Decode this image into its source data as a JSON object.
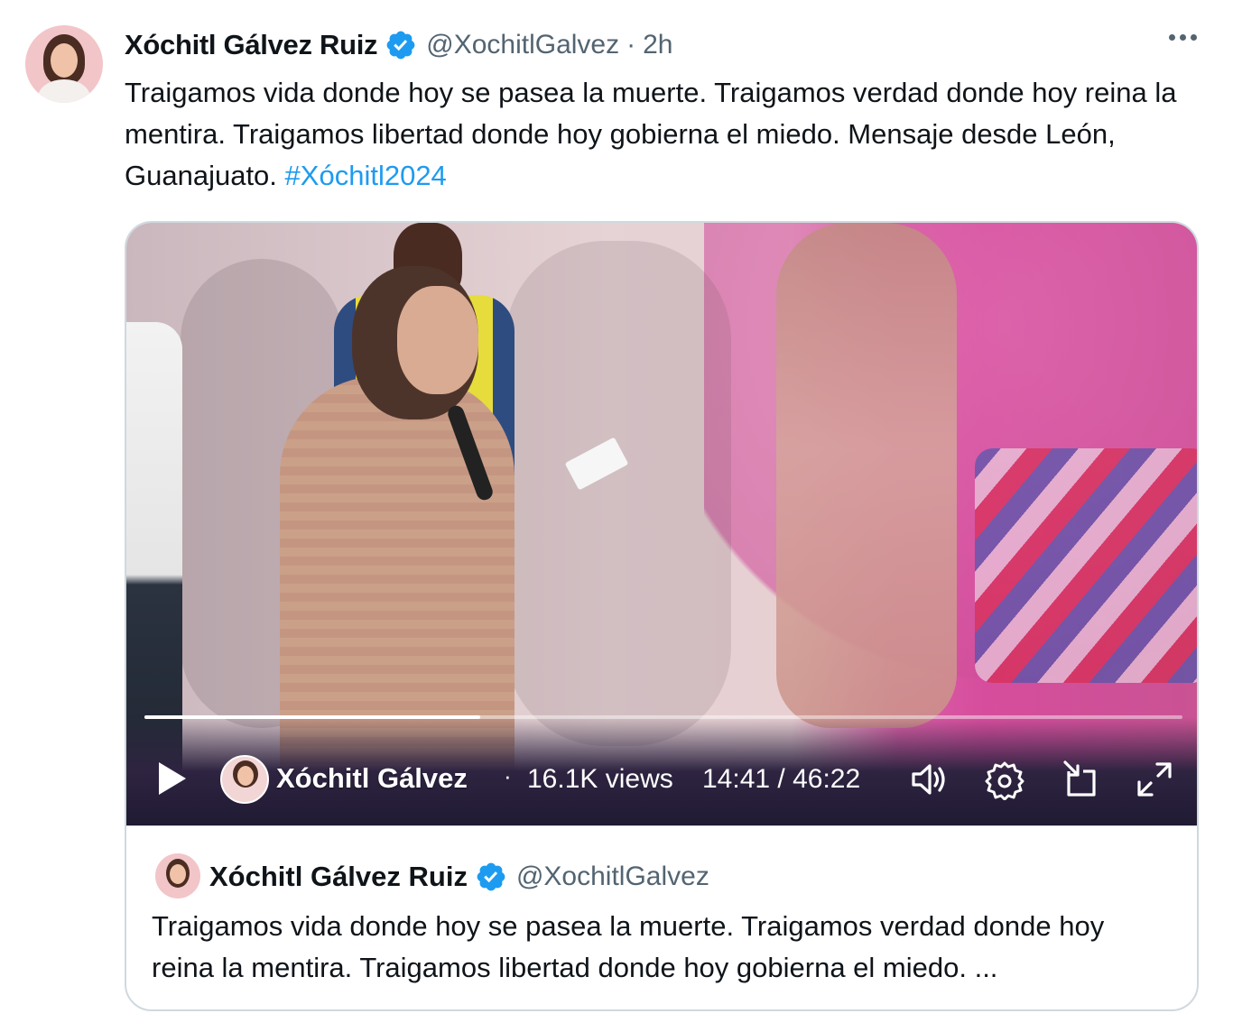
{
  "tweet": {
    "author_name": "Xóchitl Gálvez Ruiz",
    "handle": "@XochitlGalvez",
    "separator": "·",
    "time": "2h",
    "text": "Traigamos vida donde hoy se pasea la muerte. Traigamos verdad donde hoy reina la mentira. Traigamos libertad donde hoy gobierna el miedo.  Mensaje desde León, Guanajuato.",
    "hashtag": "#Xóchitl2024",
    "more_icon": "more-horizontal-icon",
    "verified_icon": "verified-badge-icon"
  },
  "video": {
    "progress": 0.3236,
    "channel_name": "Xóchitl Gálvez",
    "separator": "·",
    "views": "16.1K views",
    "time_display": "14:41 / 46:22",
    "icons": [
      "play-icon",
      "volume-icon",
      "settings-icon",
      "pip-icon",
      "fullscreen-icon"
    ]
  },
  "quoted": {
    "author_name": "Xóchitl Gálvez Ruiz",
    "handle": "@XochitlGalvez",
    "text": "Traigamos vida donde hoy se pasea la muerte. Traigamos verdad donde hoy reina la mentira. Traigamos libertad donde hoy gobierna el miedo. ..."
  },
  "colors": {
    "accent": "#1d9bf0",
    "text": "#0f1419",
    "muted": "#536471",
    "border": "#cfd9de"
  }
}
